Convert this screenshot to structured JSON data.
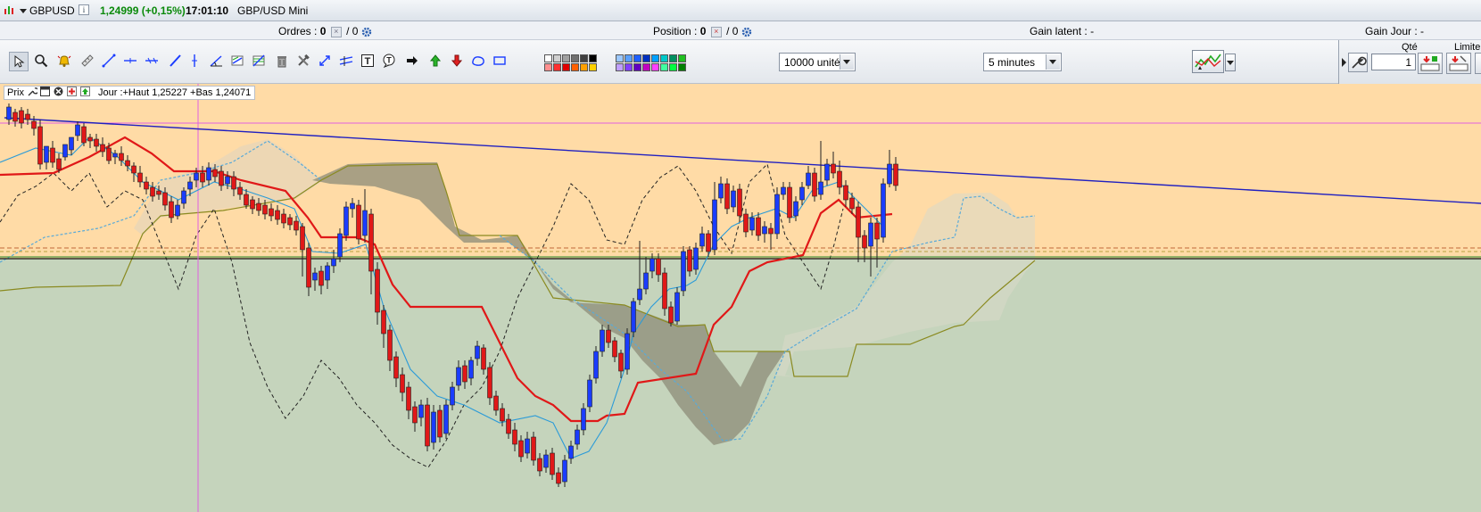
{
  "instrument": {
    "symbol": "GBPUSD",
    "price": "1,24999 (+0,15%)",
    "time": "17:01:10",
    "name": "GBP/USD Mini"
  },
  "status": {
    "orders_label": "Ordres :",
    "orders_count": "0",
    "orders_total": "/ 0",
    "position_label": "Position :",
    "position_count": "0",
    "position_total": "/ 0",
    "gain_latent_label": "Gain latent :",
    "gain_latent_value": "-",
    "gain_jour_label": "Gain Jour :",
    "gain_jour_value": "-"
  },
  "toolbar": {
    "quantity_select": "10000 unités",
    "timeframe_select": "5 minutes",
    "qty_label": "Qté",
    "qty_value": "1",
    "limit_label": "Limite"
  },
  "chart_header": {
    "price_label": "Prix",
    "day_info": "Jour :+Haut 1,25227 +Bas 1,24071"
  },
  "colors": {
    "bull_candle": "#1a3cff",
    "bear_candle": "#e01818",
    "kijun": "#e01818",
    "tenkan": "#2b9bd8",
    "chikou": "#222222",
    "trendline": "#2020c0",
    "price_up_text": "#0a8a0a",
    "chart_upper_bg": "#ffdba6",
    "chart_lower_bg": "#c5d4bc"
  }
}
